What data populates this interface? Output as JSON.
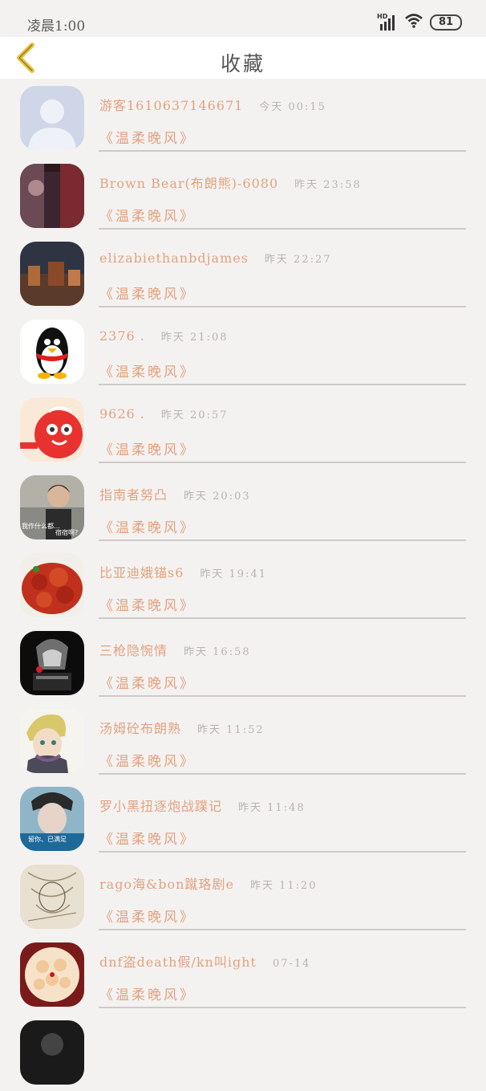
{
  "status": {
    "time": "凌晨1:00",
    "battery": "81",
    "network": "HD"
  },
  "header": {
    "title": "收藏"
  },
  "items": [
    {
      "name": "游客1610637146671",
      "time": "今天 00:15",
      "song": "《温柔晚风》"
    },
    {
      "name": "Brown Bear(布朗熊)-6080",
      "time": "昨天 23:58",
      "song": "《温柔晚风》"
    },
    {
      "name": "elizabiethanbdjames",
      "time": "昨天 22:27",
      "song": "《温柔晚风》"
    },
    {
      "name": "2376 .",
      "time": "昨天 21:08",
      "song": "《温柔晚风》"
    },
    {
      "name": "9626 .",
      "time": "昨天 20:57",
      "song": "《温柔晚风》"
    },
    {
      "name": "指南者努凸",
      "time": "昨天 20:03",
      "song": "《温柔晚风》"
    },
    {
      "name": "比亚迪娥锚s6",
      "time": "昨天 19:41",
      "song": "《温柔晚风》"
    },
    {
      "name": "三枪隐惋情",
      "time": "昨天 16:58",
      "song": "《温柔晚风》"
    },
    {
      "name": "汤姆砼布朗熟",
      "time": "昨天 11:52",
      "song": "《温柔晚风》"
    },
    {
      "name": "罗小黑扭逐炮战蹼记",
      "time": "昨天 11:48",
      "song": "《温柔晚风》"
    },
    {
      "name": "rago海&bon蹴珞剧e",
      "time": "昨天 11:20",
      "song": "《温柔晚风》"
    },
    {
      "name": "dnf盗death假/kn叫ight",
      "time": "07-14",
      "song": "《温柔晚风》"
    }
  ],
  "avatar_captions": {
    "item5": "我作什么都…",
    "item5b": "宿宿啊?",
    "item9": "留你、已满足"
  },
  "colors": {
    "accent": "#e2a27f",
    "back_arrow": "#e8c23d",
    "time": "#b9b3b0",
    "divider": "#cfcac8"
  }
}
